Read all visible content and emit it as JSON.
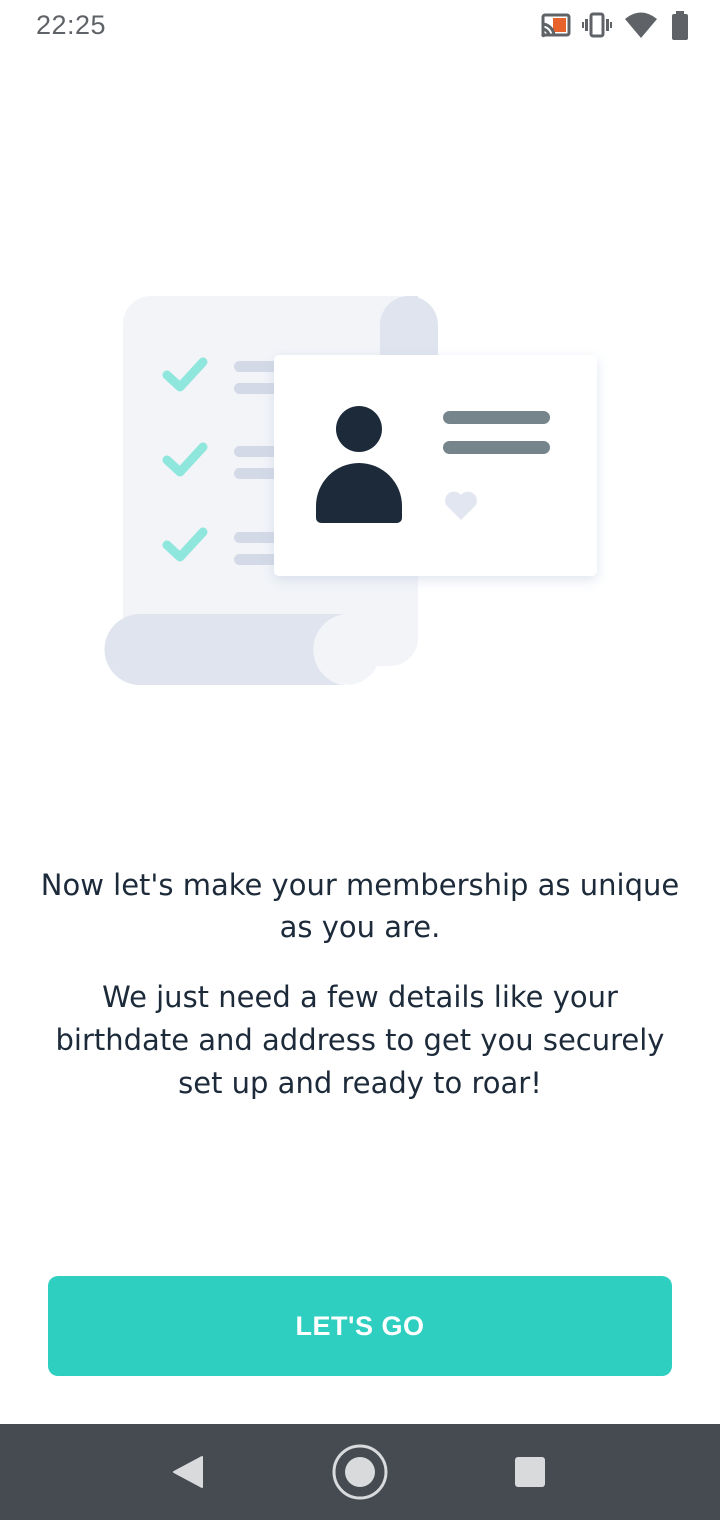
{
  "status_bar": {
    "time": "22:25",
    "icons": [
      "cast-icon",
      "vibrate-icon",
      "wifi-icon",
      "battery-icon"
    ],
    "cast_accent_color": "#e8622c"
  },
  "illustration": {
    "icon": "membership-card-illustration",
    "colors": {
      "paper": "#f2f4f8",
      "paper_shade": "#dfe4ef",
      "check": "#8fe6dd",
      "line": "#d3d9e6",
      "avatar": "#1c2a3a",
      "card_lines": "#76848c",
      "heart": "#e2e6f0"
    }
  },
  "content": {
    "headline": "Now let's make your membership as unique as you are.",
    "body": "We just need a few details like your birthdate and address to get you securely set up and ready to roar!"
  },
  "cta": {
    "label": "LET'S GO",
    "color": "#2ecfc0"
  },
  "nav_bar": {
    "background": "#464a51",
    "buttons": [
      "back-icon",
      "home-icon",
      "recents-icon"
    ]
  }
}
